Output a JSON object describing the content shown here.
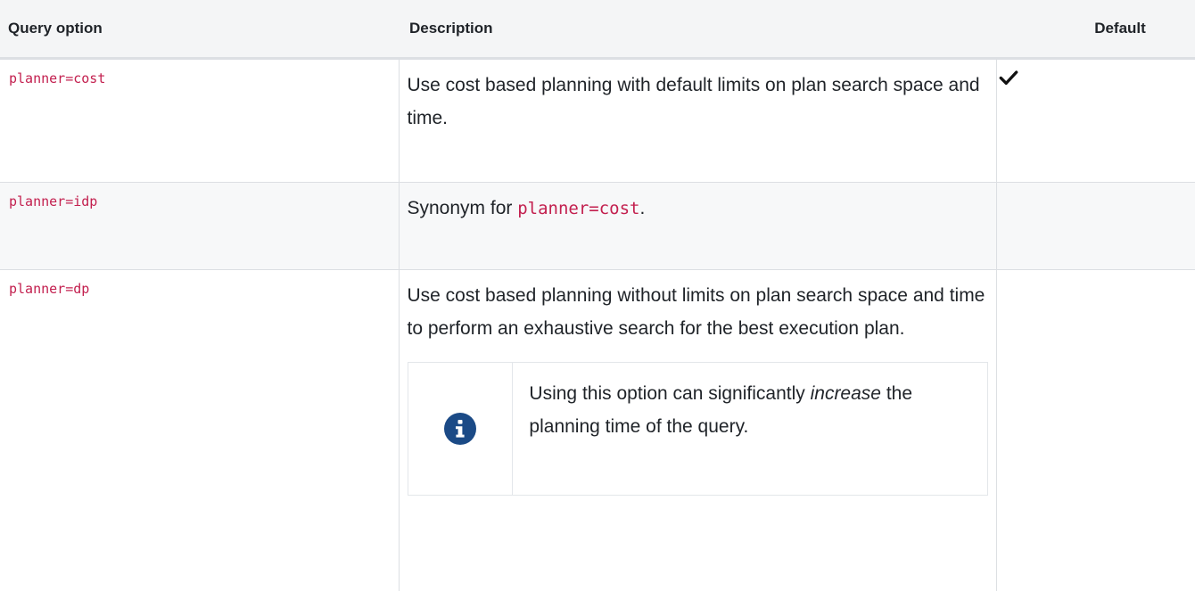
{
  "table": {
    "headers": {
      "option": "Query option",
      "description": "Description",
      "default": "Default"
    },
    "rows": [
      {
        "option": "planner=cost",
        "description": "Use cost based planning with default limits on plan search space and time.",
        "default": true
      },
      {
        "option": "planner=idp",
        "description_prefix": "Synonym for ",
        "description_code": "planner=cost",
        "description_suffix": ".",
        "default": false
      },
      {
        "option": "planner=dp",
        "description": "Use cost based planning without limits on plan search space and time to perform an exhaustive search for the best execution plan.",
        "default": false,
        "note": {
          "icon": "info-icon",
          "text_before": "Using this option can significantly ",
          "text_emphasis": "increase",
          "text_after": " the planning time of the query."
        }
      }
    ]
  },
  "colors": {
    "code": "#c3204f",
    "info_badge": "#1b4a86",
    "header_bg": "#f4f5f6",
    "border": "#dcdfe3"
  }
}
